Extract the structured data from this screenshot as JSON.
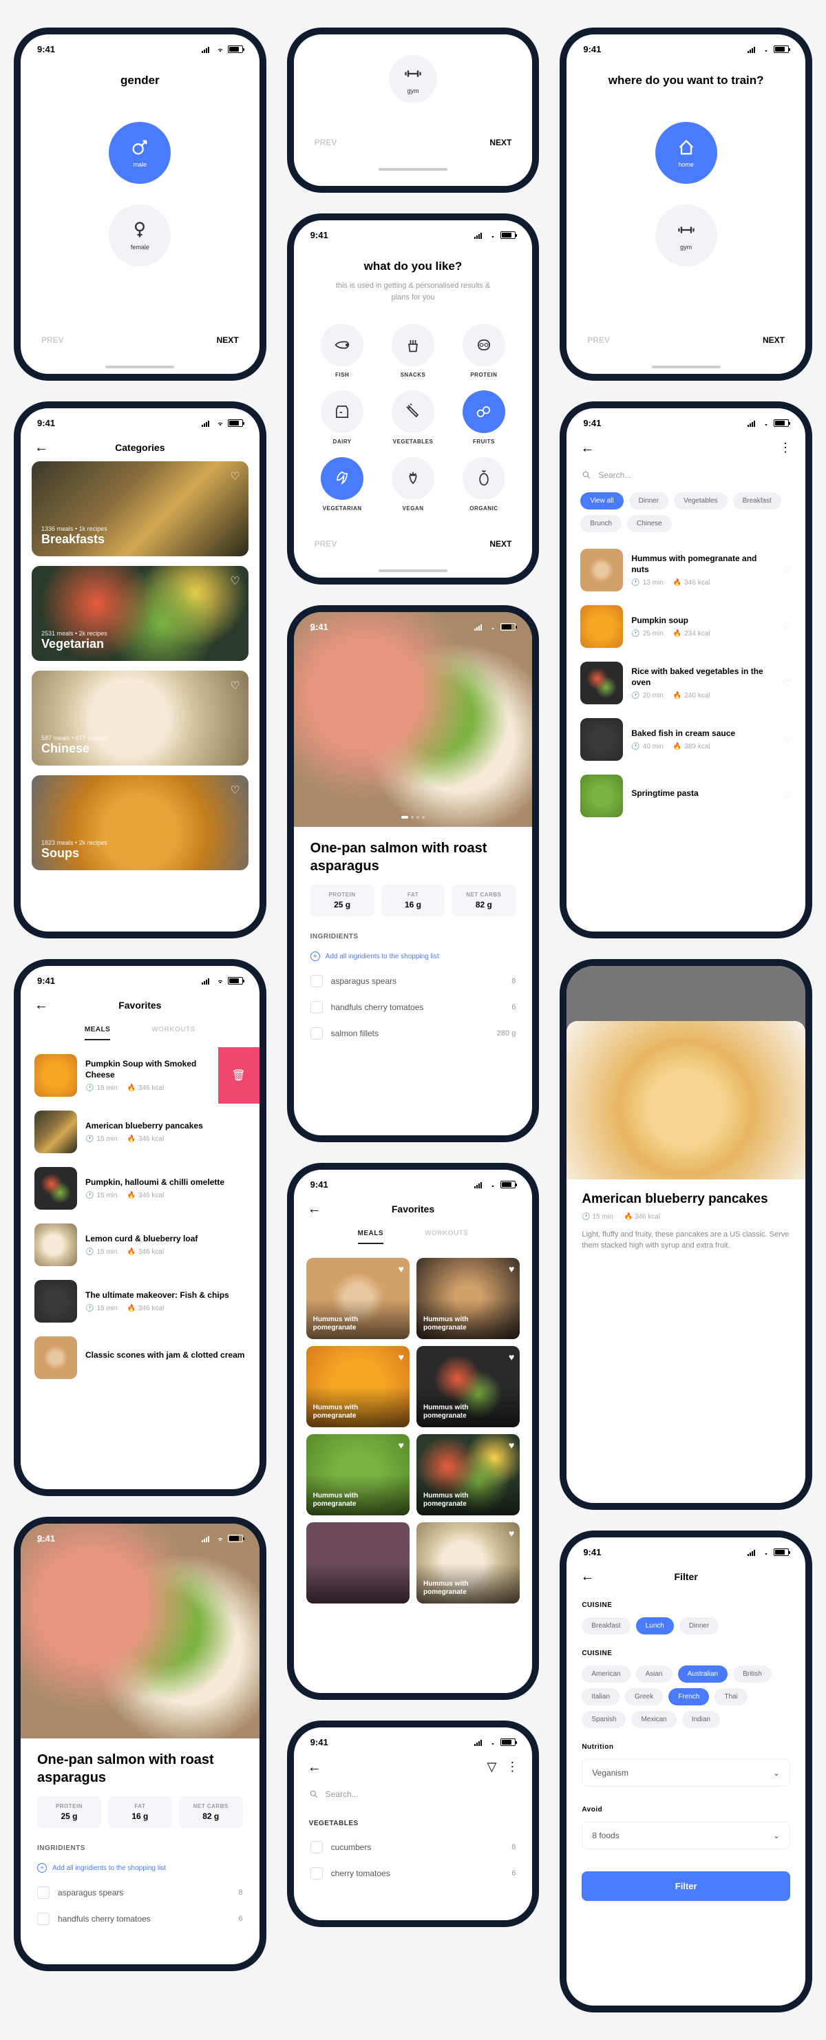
{
  "status": {
    "time": "9:41"
  },
  "nav": {
    "prev": "PREV",
    "next": "NEXT"
  },
  "onboard_gender": {
    "title": "gender",
    "opts": [
      {
        "label": "male"
      },
      {
        "label": "female"
      }
    ]
  },
  "onboard_train": {
    "title": "where do you want to train?",
    "opts": [
      {
        "label": "home"
      },
      {
        "label": "gym"
      }
    ]
  },
  "onboard_like": {
    "title": "what do you like?",
    "sub": "this is used in getting & personalised results & plans for you",
    "items": [
      "FISH",
      "SNACKS",
      "PROTEIN",
      "DAIRY",
      "VEGETABLES",
      "FRUITS",
      "VEGETARIAN",
      "VEGAN",
      "ORGANIC"
    ]
  },
  "onboard_gym_top": {
    "label": "gym"
  },
  "categories": {
    "title": "Categories",
    "items": [
      {
        "meta": "1336 meals • 1k recipes",
        "title": "Breakfasts"
      },
      {
        "meta": "2531 meals • 2k recipes",
        "title": "Vegetarian"
      },
      {
        "meta": "587 meals • 677 recipes",
        "title": "Chinese"
      },
      {
        "meta": "1823 meals • 2k recipes",
        "title": "Soups"
      }
    ]
  },
  "search": {
    "placeholder": "Search...",
    "chips": [
      "View all",
      "Dinner",
      "Vegetables",
      "Breakfast",
      "Brunch",
      "Chinese"
    ],
    "recipes": [
      {
        "name": "Hummus with pomegranate and nuts",
        "time": "13 min",
        "kcal": "346 kcal"
      },
      {
        "name": "Pumpkin soup",
        "time": "25 min",
        "kcal": "234 kcal"
      },
      {
        "name": "Rice with baked vegetables in the oven",
        "time": "20 min",
        "kcal": "240 kcal"
      },
      {
        "name": "Baked fish in cream sauce",
        "time": "40 min",
        "kcal": "389 kcal"
      },
      {
        "name": "Springtime pasta",
        "time": "",
        "kcal": ""
      }
    ]
  },
  "favorites_list": {
    "title": "Favorites",
    "tabs": [
      "MEALS",
      "WORKOUTS"
    ],
    "items": [
      {
        "name": "Pumpkin Soup with Smoked Cheese",
        "time": "15 min",
        "kcal": "346 kcal",
        "delete": true
      },
      {
        "name": "American blueberry pancakes",
        "time": "15 min",
        "kcal": "346 kcal"
      },
      {
        "name": "Pumpkin, halloumi & chilli omelette",
        "time": "15 min",
        "kcal": "346 kcal"
      },
      {
        "name": "Lemon curd & blueberry loaf",
        "time": "15 min",
        "kcal": "346 kcal"
      },
      {
        "name": "The ultimate makeover: Fish & chips",
        "time": "15 min",
        "kcal": "346 kcal"
      },
      {
        "name": "Classic scones with jam & clotted cream",
        "time": "",
        "kcal": ""
      }
    ]
  },
  "recipe_detail": {
    "title": "One-pan salmon with roast asparagus",
    "macros": [
      {
        "label": "PROTEIN",
        "value": "25 g"
      },
      {
        "label": "FAT",
        "value": "16 g"
      },
      {
        "label": "NET CARBS",
        "value": "82 g"
      }
    ],
    "section": "INGRIDIENTS",
    "add_all": "Add all ingridients to the shopping list",
    "ingredients": [
      {
        "name": "asparagus spears",
        "qty": "8"
      },
      {
        "name": "handfuls cherry tomatoes",
        "qty": "6"
      },
      {
        "name": "salmon fillets",
        "qty": "280 g"
      }
    ]
  },
  "recipe_detail2": {
    "title": "One-pan salmon with roast asparagus",
    "ingredients": [
      {
        "name": "asparagus spears",
        "qty": "8"
      },
      {
        "name": "handfuls cherry tomatoes",
        "qty": "6"
      }
    ]
  },
  "favorites_grid": {
    "title": "Favorites",
    "items": [
      "Hummus with pomegranate",
      "Hummus with pomegranate",
      "Hummus with pomegranate",
      "Hummus with pomegranate",
      "Hummus with pomegranate",
      "Hummus with pomegranate",
      "",
      "Hummus with pomegranate"
    ]
  },
  "modal": {
    "title": "American blueberry pancakes",
    "time": "15 min",
    "kcal": "346 kcal",
    "desc": "Light, fluffy and fruity, these pancakes are a US classic. Serve them stacked high with syrup and extra fruit."
  },
  "filter": {
    "title": "Filter",
    "cuisine_label": "CUISINE",
    "meal_chips": [
      "Breakfast",
      "Lunch",
      "Dinner"
    ],
    "cuisine_chips": [
      "American",
      "Asian",
      "Australian",
      "British",
      "Italian",
      "Greek",
      "French",
      "Thai",
      "Spanish",
      "Mexican",
      "Indian"
    ],
    "nutrition_label": "Nutrition",
    "nutrition_value": "Veganism",
    "avoid_label": "Avoid",
    "avoid_value": "8 foods",
    "button": "Filter"
  },
  "ingredients_search": {
    "placeholder": "Search...",
    "section": "VEGETABLES",
    "items": [
      {
        "name": "cucumbers",
        "qty": "8"
      },
      {
        "name": "cherry tomatoes",
        "qty": "6"
      }
    ]
  }
}
